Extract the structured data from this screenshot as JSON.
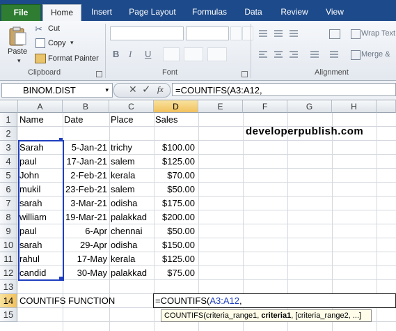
{
  "ribbon": {
    "tabs": [
      "File",
      "Home",
      "Insert",
      "Page Layout",
      "Formulas",
      "Data",
      "Review",
      "View"
    ],
    "clipboard": {
      "paste": "Paste",
      "cut": "Cut",
      "copy": "Copy",
      "format_painter": "Format Painter",
      "label": "Clipboard"
    },
    "font": {
      "label": "Font",
      "bold": "B",
      "italic": "I",
      "underline": "U"
    },
    "alignment": {
      "wrap_text": "Wrap Text",
      "merge": "Merge &",
      "label": "Alignment"
    }
  },
  "formula_bar": {
    "name_box": "BINOM.DIST",
    "fx": "fx",
    "formula": "=COUNTIFS(A3:A12,"
  },
  "grid": {
    "columns": [
      "A",
      "B",
      "C",
      "D",
      "E",
      "F",
      "G",
      "H"
    ],
    "rows": [
      "1",
      "2",
      "3",
      "4",
      "5",
      "6",
      "7",
      "8",
      "9",
      "10",
      "11",
      "12",
      "13",
      "14",
      "15"
    ],
    "headers": {
      "name": "Name",
      "date": "Date",
      "place": "Place",
      "sales": "Sales"
    },
    "data": [
      {
        "name": "Sarah",
        "date": "5-Jan-21",
        "place": "trichy",
        "sales": "$100.00"
      },
      {
        "name": "paul",
        "date": "17-Jan-21",
        "place": "salem",
        "sales": "$125.00"
      },
      {
        "name": "John",
        "date": "2-Feb-21",
        "place": "kerala",
        "sales": "$70.00"
      },
      {
        "name": "mukil",
        "date": "23-Feb-21",
        "place": "salem",
        "sales": "$50.00"
      },
      {
        "name": "sarah",
        "date": "3-Mar-21",
        "place": "odisha",
        "sales": "$175.00"
      },
      {
        "name": "william",
        "date": "19-Mar-21",
        "place": "palakkad",
        "sales": "$200.00"
      },
      {
        "name": "paul",
        "date": "6-Apr",
        "place": "chennai",
        "sales": "$50.00"
      },
      {
        "name": "sarah",
        "date": "29-Apr",
        "place": "odisha",
        "sales": "$150.00"
      },
      {
        "name": "rahul",
        "date": "17-May",
        "place": "kerala",
        "sales": "$125.00"
      },
      {
        "name": "candid",
        "date": "30-May",
        "place": "palakkad",
        "sales": "$75.00"
      }
    ],
    "label_a14": "COUNTIFS FUNCTION",
    "edit_prefix": "=COUNTIFS(",
    "edit_ref": "A3:A12",
    "edit_suffix": ",",
    "tooltip_fn": "COUNTIFS(criteria_range1, ",
    "tooltip_bold": "criteria1",
    "tooltip_rest": ", [criteria_range2, ...]",
    "watermark": "developerpublish.com"
  },
  "colors": {
    "accent": "#1d4a8a",
    "file_tab": "#2e7d32",
    "selection": "#f1c15c",
    "range_border": "#1f3fbf"
  }
}
